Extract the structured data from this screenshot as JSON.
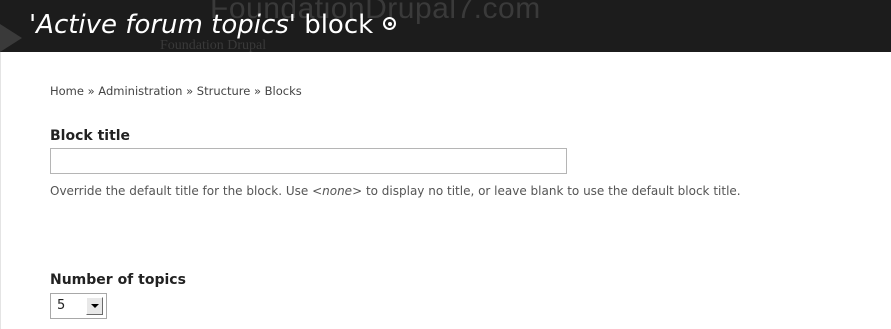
{
  "header": {
    "title_quote_open": "'",
    "title_italic": "Active forum topics",
    "title_rest": "' block",
    "shortcut_icon": "circle-dot-icon",
    "watermark_line1": "FoundationDrupal7.com",
    "watermark_line2": "Foundation Drupal"
  },
  "breadcrumb": {
    "text": "Home » Administration » Structure » Blocks"
  },
  "block_title": {
    "label": "Block title",
    "value": "",
    "description_prefix": "Override the default title for the block. Use ",
    "description_code": "<none>",
    "description_suffix": " to display no title, or leave blank to use the default block title."
  },
  "number_of_topics": {
    "label": "Number of topics",
    "selected": "5",
    "dropdown_icon": "chevron-down-icon"
  },
  "colors": {
    "header_bg": "#1c1c1c",
    "header_text": "#ffffff",
    "page_bg": "#ffffff"
  }
}
